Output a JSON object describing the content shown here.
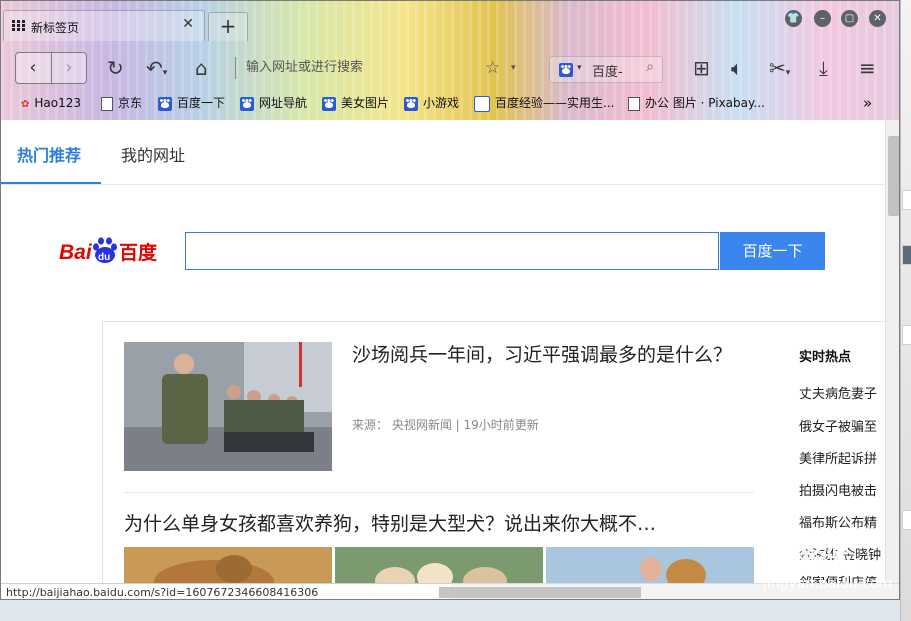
{
  "browser": {
    "tab_title": "新标签页",
    "address_placeholder": "输入网址或进行搜索",
    "search_engine_label": "百度-",
    "bookmarks": [
      {
        "label": "Hao123",
        "icon": "hao123-icon"
      },
      {
        "label": "京东",
        "icon": "folder-icon"
      },
      {
        "label": "百度一下",
        "icon": "baidu-paw-icon"
      },
      {
        "label": "网址导航",
        "icon": "baidu-paw-icon"
      },
      {
        "label": "美女图片",
        "icon": "baidu-paw-icon"
      },
      {
        "label": "小游戏",
        "icon": "baidu-paw-icon"
      },
      {
        "label": "百度经验——实用生...",
        "icon": "baidu-jingyan-icon"
      },
      {
        "label": "办公 图片 · Pixabay...",
        "icon": "file-icon"
      }
    ]
  },
  "page": {
    "tabs": [
      "热门推荐",
      "我的网址"
    ],
    "search_button": "百度一下",
    "news": [
      {
        "title": "沙场阅兵一年间，习近平强调最多的是什么？",
        "source": "来源： 央视网新闻 | 19小时前更新"
      },
      {
        "title": "为什么单身女孩都喜欢养狗，特别是大型犬？说出来你大概不…"
      }
    ],
    "hot_title": "实时热点",
    "hot_items": [
      "丈夫病危妻子",
      "俄女子被骗至",
      "美律所起诉拼",
      "拍摄闪电被击",
      "福布斯公布精",
      "金泫雅 金晓钟",
      "邻家便利店停"
    ]
  },
  "status_url": "http://baijiahao.baidu.com/s?id=1607672346608416306",
  "colors": {
    "accent": "#2f7de1",
    "baidu_red": "#e10602",
    "baidu_blue": "#2932e1"
  }
}
